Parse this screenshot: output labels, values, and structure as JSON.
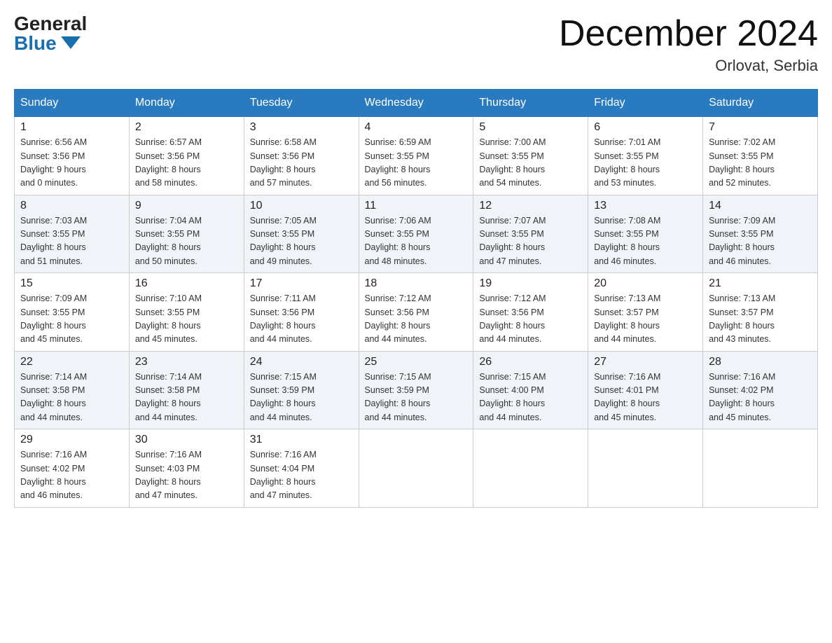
{
  "header": {
    "logo_general": "General",
    "logo_blue": "Blue",
    "month_title": "December 2024",
    "location": "Orlovat, Serbia"
  },
  "days_of_week": [
    "Sunday",
    "Monday",
    "Tuesday",
    "Wednesday",
    "Thursday",
    "Friday",
    "Saturday"
  ],
  "weeks": [
    [
      {
        "num": "1",
        "sunrise": "6:56 AM",
        "sunset": "3:56 PM",
        "daylight": "9 hours",
        "minutes": "and 0 minutes."
      },
      {
        "num": "2",
        "sunrise": "6:57 AM",
        "sunset": "3:56 PM",
        "daylight": "8 hours",
        "minutes": "and 58 minutes."
      },
      {
        "num": "3",
        "sunrise": "6:58 AM",
        "sunset": "3:56 PM",
        "daylight": "8 hours",
        "minutes": "and 57 minutes."
      },
      {
        "num": "4",
        "sunrise": "6:59 AM",
        "sunset": "3:55 PM",
        "daylight": "8 hours",
        "minutes": "and 56 minutes."
      },
      {
        "num": "5",
        "sunrise": "7:00 AM",
        "sunset": "3:55 PM",
        "daylight": "8 hours",
        "minutes": "and 54 minutes."
      },
      {
        "num": "6",
        "sunrise": "7:01 AM",
        "sunset": "3:55 PM",
        "daylight": "8 hours",
        "minutes": "and 53 minutes."
      },
      {
        "num": "7",
        "sunrise": "7:02 AM",
        "sunset": "3:55 PM",
        "daylight": "8 hours",
        "minutes": "and 52 minutes."
      }
    ],
    [
      {
        "num": "8",
        "sunrise": "7:03 AM",
        "sunset": "3:55 PM",
        "daylight": "8 hours",
        "minutes": "and 51 minutes."
      },
      {
        "num": "9",
        "sunrise": "7:04 AM",
        "sunset": "3:55 PM",
        "daylight": "8 hours",
        "minutes": "and 50 minutes."
      },
      {
        "num": "10",
        "sunrise": "7:05 AM",
        "sunset": "3:55 PM",
        "daylight": "8 hours",
        "minutes": "and 49 minutes."
      },
      {
        "num": "11",
        "sunrise": "7:06 AM",
        "sunset": "3:55 PM",
        "daylight": "8 hours",
        "minutes": "and 48 minutes."
      },
      {
        "num": "12",
        "sunrise": "7:07 AM",
        "sunset": "3:55 PM",
        "daylight": "8 hours",
        "minutes": "and 47 minutes."
      },
      {
        "num": "13",
        "sunrise": "7:08 AM",
        "sunset": "3:55 PM",
        "daylight": "8 hours",
        "minutes": "and 46 minutes."
      },
      {
        "num": "14",
        "sunrise": "7:09 AM",
        "sunset": "3:55 PM",
        "daylight": "8 hours",
        "minutes": "and 46 minutes."
      }
    ],
    [
      {
        "num": "15",
        "sunrise": "7:09 AM",
        "sunset": "3:55 PM",
        "daylight": "8 hours",
        "minutes": "and 45 minutes."
      },
      {
        "num": "16",
        "sunrise": "7:10 AM",
        "sunset": "3:55 PM",
        "daylight": "8 hours",
        "minutes": "and 45 minutes."
      },
      {
        "num": "17",
        "sunrise": "7:11 AM",
        "sunset": "3:56 PM",
        "daylight": "8 hours",
        "minutes": "and 44 minutes."
      },
      {
        "num": "18",
        "sunrise": "7:12 AM",
        "sunset": "3:56 PM",
        "daylight": "8 hours",
        "minutes": "and 44 minutes."
      },
      {
        "num": "19",
        "sunrise": "7:12 AM",
        "sunset": "3:56 PM",
        "daylight": "8 hours",
        "minutes": "and 44 minutes."
      },
      {
        "num": "20",
        "sunrise": "7:13 AM",
        "sunset": "3:57 PM",
        "daylight": "8 hours",
        "minutes": "and 44 minutes."
      },
      {
        "num": "21",
        "sunrise": "7:13 AM",
        "sunset": "3:57 PM",
        "daylight": "8 hours",
        "minutes": "and 43 minutes."
      }
    ],
    [
      {
        "num": "22",
        "sunrise": "7:14 AM",
        "sunset": "3:58 PM",
        "daylight": "8 hours",
        "minutes": "and 44 minutes."
      },
      {
        "num": "23",
        "sunrise": "7:14 AM",
        "sunset": "3:58 PM",
        "daylight": "8 hours",
        "minutes": "and 44 minutes."
      },
      {
        "num": "24",
        "sunrise": "7:15 AM",
        "sunset": "3:59 PM",
        "daylight": "8 hours",
        "minutes": "and 44 minutes."
      },
      {
        "num": "25",
        "sunrise": "7:15 AM",
        "sunset": "3:59 PM",
        "daylight": "8 hours",
        "minutes": "and 44 minutes."
      },
      {
        "num": "26",
        "sunrise": "7:15 AM",
        "sunset": "4:00 PM",
        "daylight": "8 hours",
        "minutes": "and 44 minutes."
      },
      {
        "num": "27",
        "sunrise": "7:16 AM",
        "sunset": "4:01 PM",
        "daylight": "8 hours",
        "minutes": "and 45 minutes."
      },
      {
        "num": "28",
        "sunrise": "7:16 AM",
        "sunset": "4:02 PM",
        "daylight": "8 hours",
        "minutes": "and 45 minutes."
      }
    ],
    [
      {
        "num": "29",
        "sunrise": "7:16 AM",
        "sunset": "4:02 PM",
        "daylight": "8 hours",
        "minutes": "and 46 minutes."
      },
      {
        "num": "30",
        "sunrise": "7:16 AM",
        "sunset": "4:03 PM",
        "daylight": "8 hours",
        "minutes": "and 47 minutes."
      },
      {
        "num": "31",
        "sunrise": "7:16 AM",
        "sunset": "4:04 PM",
        "daylight": "8 hours",
        "minutes": "and 47 minutes."
      },
      null,
      null,
      null,
      null
    ]
  ]
}
